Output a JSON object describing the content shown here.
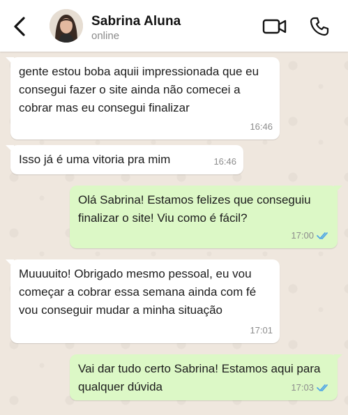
{
  "header": {
    "contact_name": "Sabrina Aluna",
    "status": "online",
    "back_icon": "chevron-left-icon",
    "video_icon": "video-camera-icon",
    "call_icon": "phone-icon"
  },
  "colors": {
    "incoming_bubble": "#ffffff",
    "outgoing_bubble": "#dcf8c6",
    "read_ticks": "#4fa6e6",
    "chat_background": "#efe7de"
  },
  "messages": [
    {
      "direction": "in",
      "text": "gente estou boba aquii impressionada que eu consegui fazer o site ainda não comecei a cobrar mas eu consegui finalizar",
      "time": "16:46"
    },
    {
      "direction": "in",
      "text": "Isso já é uma vitoria pra mim",
      "time": "16:46"
    },
    {
      "direction": "out",
      "text": "Olá Sabrina! Estamos felizes que conseguiu finalizar o site! Viu como é fácil?",
      "time": "17:00",
      "read": true
    },
    {
      "direction": "in",
      "text": "Muuuuito! Obrigado mesmo pessoal, eu vou começar a cobrar essa semana ainda com fé vou conseguir mudar a minha situação",
      "time": "17:01"
    },
    {
      "direction": "out",
      "text": "Vai dar tudo certo Sabrina! Estamos aqui para qualquer dúvida",
      "time": "17:03",
      "read": true
    }
  ]
}
